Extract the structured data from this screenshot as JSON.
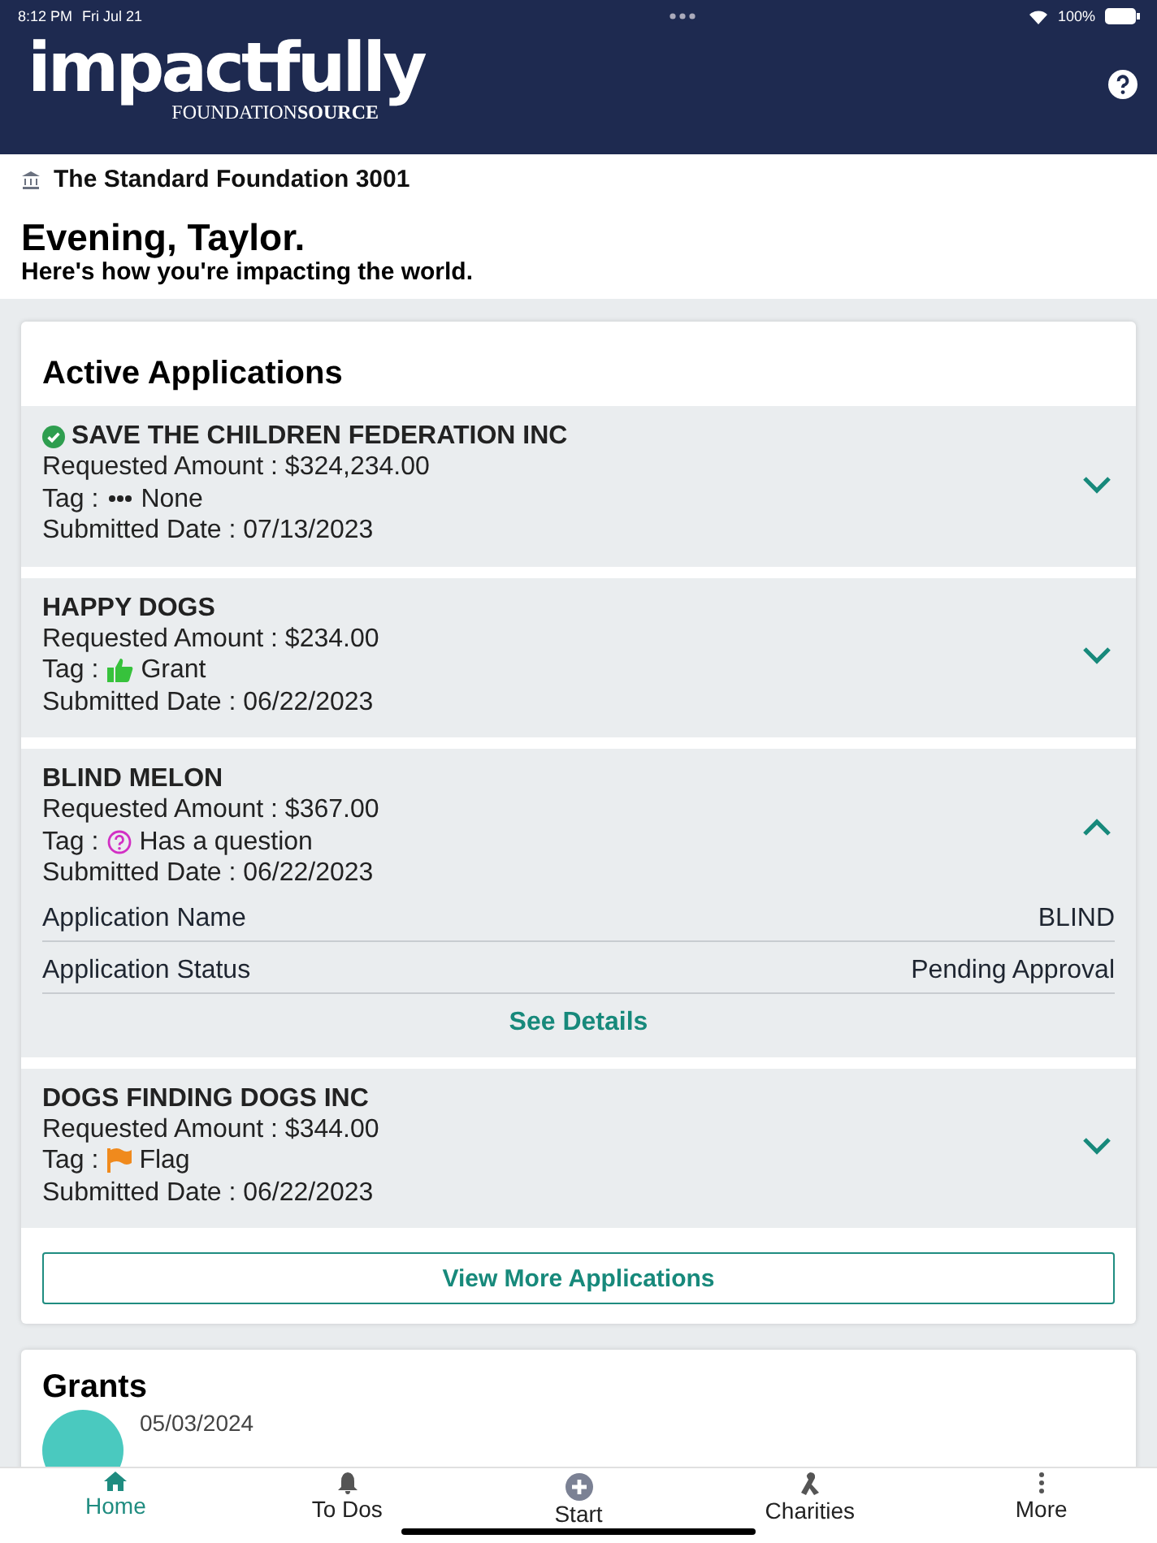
{
  "status_bar": {
    "time": "8:12 PM",
    "date": "Fri Jul 21",
    "battery": "100%"
  },
  "header": {
    "logo": "impactfully",
    "logo_sub": "FOUNDATION**SOURCE**"
  },
  "foundation": "The Standard Foundation 3001",
  "greeting": {
    "title": "Evening, Taylor.",
    "subtitle": "Here's how you're impacting the world."
  },
  "active_applications": {
    "title": "Active Applications",
    "items": [
      {
        "name": "SAVE THE CHILDREN FEDERATION INC",
        "verified": true,
        "amount": "Requested Amount : $324,234.00",
        "tag_prefix": "Tag :",
        "tag": {
          "kind": "none",
          "label": "None"
        },
        "date": "Submitted Date : 07/13/2023",
        "expanded": false
      },
      {
        "name": "HAPPY DOGS",
        "verified": false,
        "amount": "Requested Amount : $234.00",
        "tag_prefix": "Tag :",
        "tag": {
          "kind": "grant",
          "label": "Grant"
        },
        "date": "Submitted Date : 06/22/2023",
        "expanded": false
      },
      {
        "name": "BLIND MELON",
        "verified": false,
        "amount": "Requested Amount : $367.00",
        "tag_prefix": "Tag :",
        "tag": {
          "kind": "question",
          "label": "Has a question"
        },
        "date": "Submitted Date : 06/22/2023",
        "expanded": true,
        "details": [
          {
            "label": "Application Name",
            "value": "BLIND"
          },
          {
            "label": "Application Status",
            "value": "Pending Approval"
          }
        ],
        "link": "See Details"
      },
      {
        "name": "DOGS FINDING DOGS INC",
        "verified": false,
        "amount": "Requested Amount : $344.00",
        "tag_prefix": "Tag :",
        "tag": {
          "kind": "flag",
          "label": "Flag"
        },
        "date": "Submitted Date : 06/22/2023",
        "expanded": false
      }
    ],
    "more_button": "View More Applications"
  },
  "grants": {
    "title": "Grants",
    "first_date": "05/03/2024"
  },
  "tab_bar": [
    {
      "label": "Home",
      "kind": "home",
      "selected": true
    },
    {
      "label": "To Dos",
      "kind": "bell",
      "selected": false
    },
    {
      "label": "Start",
      "kind": "plus",
      "selected": false
    },
    {
      "label": "Charities",
      "kind": "ribbon",
      "selected": false
    },
    {
      "label": "More",
      "kind": "more",
      "selected": false
    }
  ]
}
